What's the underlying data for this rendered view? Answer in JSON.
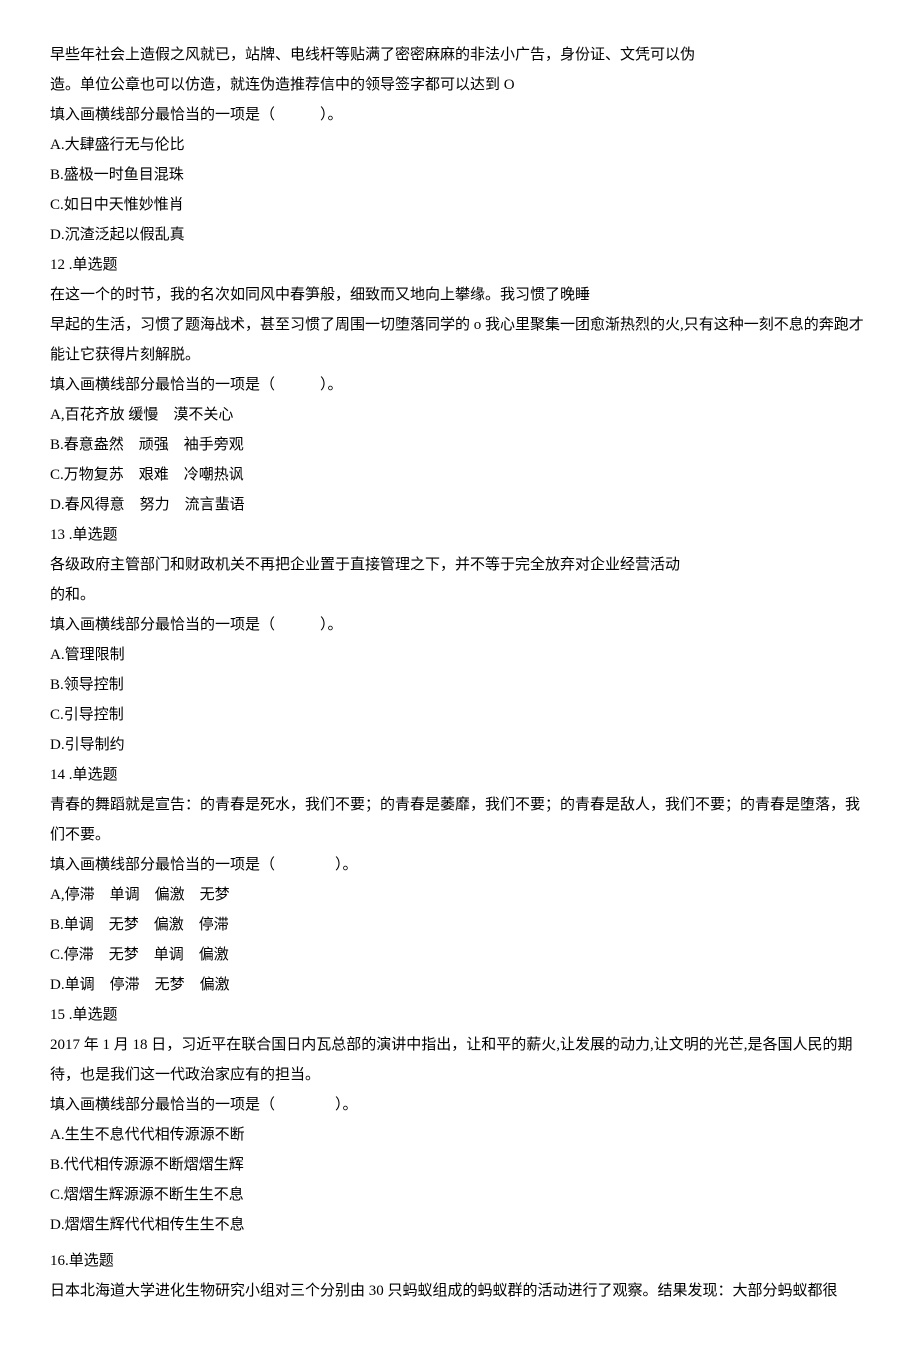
{
  "lines": [
    "早些年社会上造假之风就已，站牌、电线杆等贴满了密密麻麻的非法小广告，身份证、文凭可以伪",
    "造。单位公章也可以仿造，就连伪造推荐信中的领导签字都可以达到 O",
    "填入画横线部分最恰当的一项是（　　　）。",
    "A.大肆盛行无与伦比",
    "B.盛极一时鱼目混珠",
    "C.如日中天惟妙惟肖",
    "D.沉渣泛起以假乱真",
    "12 .单选题",
    "在这一个的时节，我的名次如同风中春笋般，细致而又地向上攀缘。我习惯了晚睡",
    "早起的生活，习惯了题海战术，甚至习惯了周围一切堕落同学的 o 我心里聚集一团愈渐热烈的火,只有这种一刻不息的奔跑才能让它获得片刻解脱。",
    "填入画横线部分最恰当的一项是（　　　）。",
    "A,百花齐放 缓慢　漠不关心",
    "B.春意盎然　顽强　袖手旁观",
    "C.万物复苏　艰难　冷嘲热讽",
    "D.春风得意　努力　流言蜚语",
    "13 .单选题",
    "各级政府主管部门和财政机关不再把企业置于直接管理之下，并不等于完全放弃对企业经营活动",
    "的和。",
    "填入画横线部分最恰当的一项是（　　　）。",
    "A.管理限制",
    "B.领导控制",
    "C.引导控制",
    "D.引导制约",
    "14 .单选题",
    "青春的舞蹈就是宣告：的青春是死水，我们不要；的青春是萎靡，我们不要；的青春是敌人，我们不要；的青春是堕落，我们不要。",
    "填入画横线部分最恰当的一项是（　　　　）。",
    "A,停滞　单调　偏激　无梦",
    "B.单调　无梦　偏激　停滞",
    "C.停滞　无梦　单调　偏激",
    "D.单调　停滞　无梦　偏激",
    "15 .单选题",
    "2017 年 1 月 18 日，习近平在联合国日内瓦总部的演讲中指出，让和平的薪火,让发展的动力,让文明的光芒,是各国人民的期待，也是我们这一代政治家应有的担当。",
    "填入画横线部分最恰当的一项是（　　　　）。",
    "A.生生不息代代相传源源不断",
    "B.代代相传源源不断熠熠生辉",
    "C.熠熠生辉源源不断生生不息",
    "D.熠熠生辉代代相传生生不息",
    "16.单选题",
    "日本北海道大学进化生物研究小组对三个分别由 30 只蚂蚁组成的蚂蚁群的活动进行了观察。结果发现：大部分蚂蚁都很"
  ],
  "gapAfter": [
    36
  ]
}
